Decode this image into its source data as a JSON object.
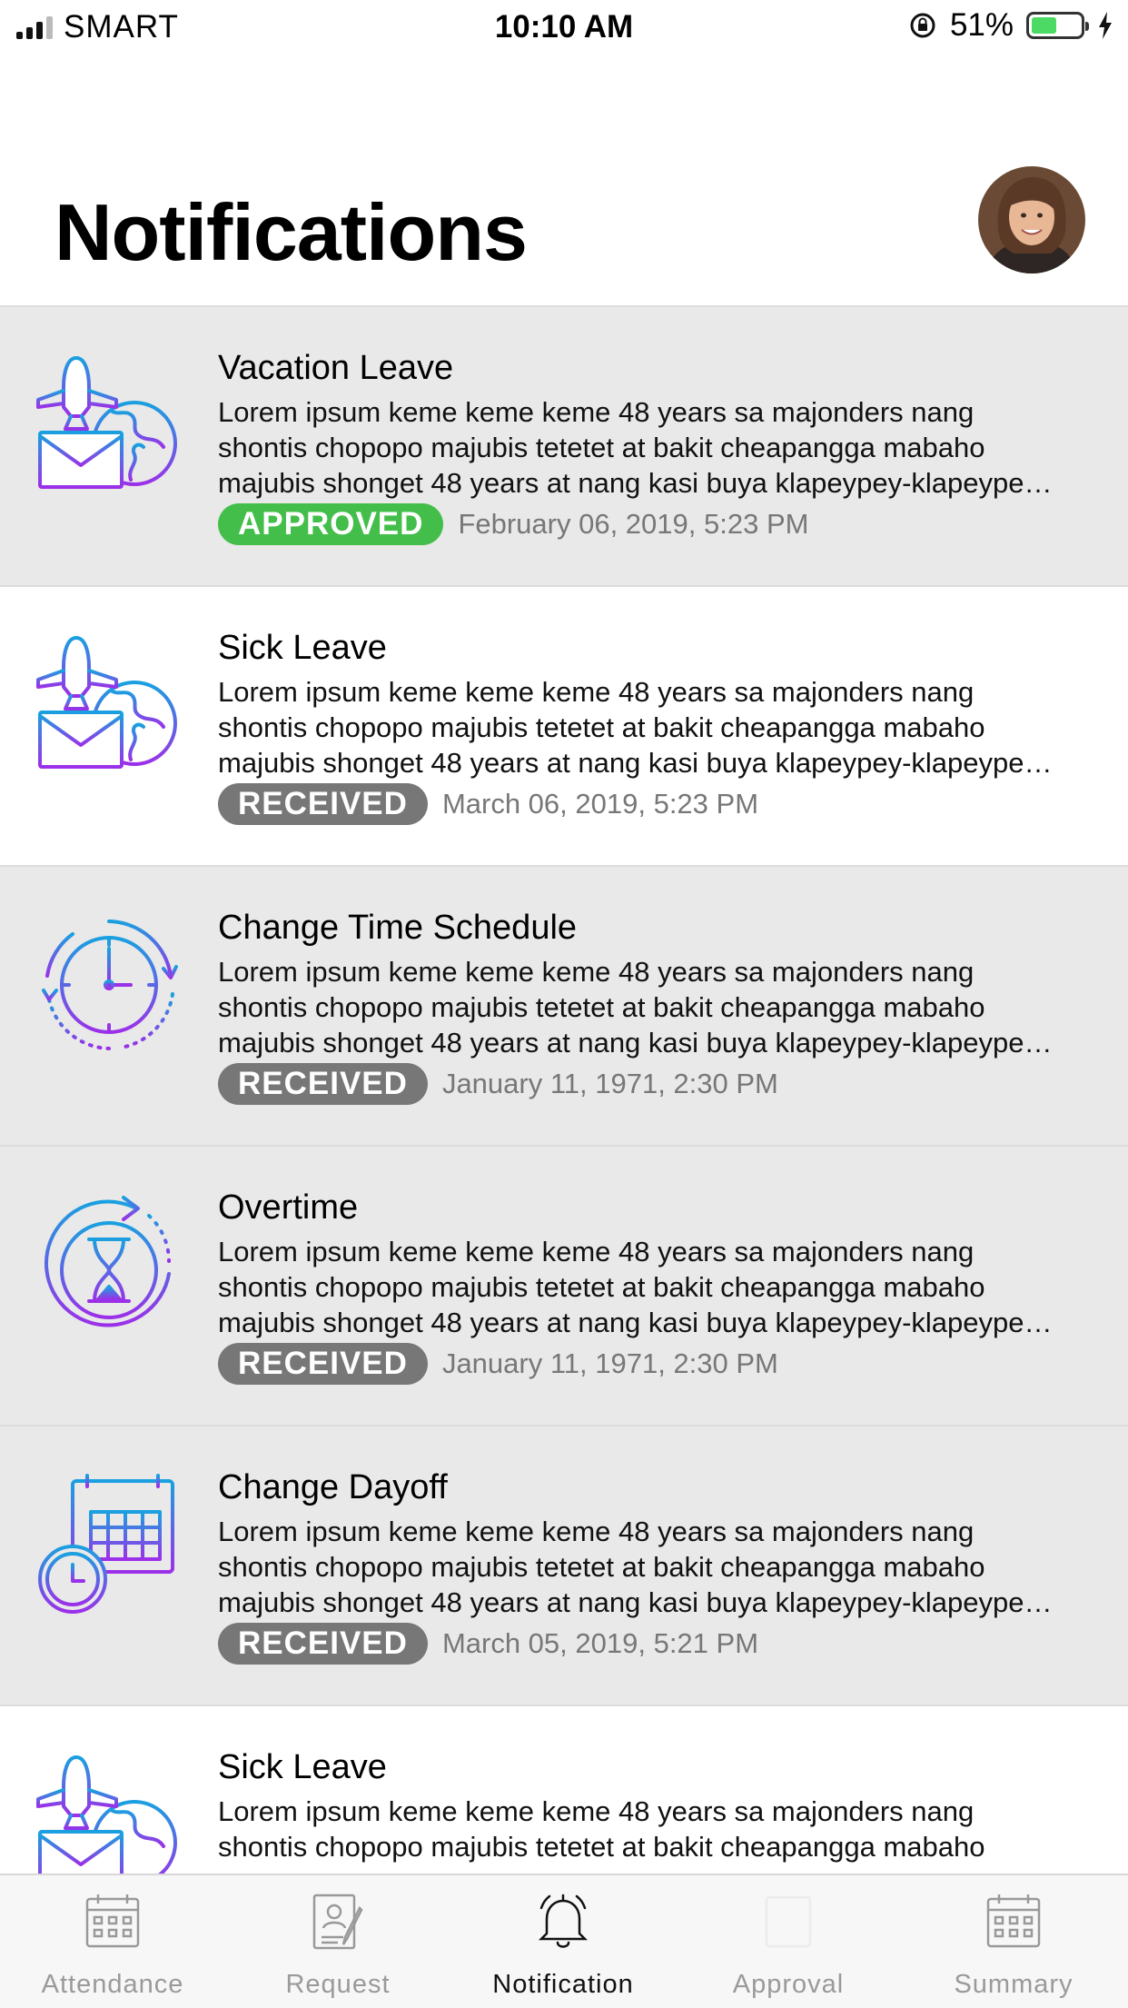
{
  "status_bar": {
    "carrier": "SMART",
    "time": "10:10 AM",
    "battery_percent": "51%",
    "battery_level": 0.51,
    "battery_color": "#4cd964"
  },
  "header": {
    "title": "Notifications"
  },
  "notifications": [
    {
      "title": "Vacation Leave",
      "icon": "plane-envelope-globe-icon",
      "body": [
        "Lorem ipsum keme keme keme 48 years sa majonders nang",
        "shontis chopopo majubis tetetet at bakit cheapangga mabaho",
        "majubis shonget 48 years at nang kasi buya klapeypey-klapeype…"
      ],
      "status": "APPROVED",
      "date": "February 06, 2019, 5:23 PM"
    },
    {
      "title": "Sick Leave",
      "icon": "plane-envelope-globe-icon",
      "body": [
        "Lorem ipsum keme keme keme 48 years sa majonders nang",
        "shontis chopopo majubis tetetet at bakit cheapangga mabaho",
        "majubis shonget 48 years at nang kasi buya klapeypey-klapeype…"
      ],
      "status": "RECEIVED",
      "date": "March 06, 2019, 5:23 PM"
    },
    {
      "title": "Change Time Schedule",
      "icon": "clock-icon",
      "body": [
        "Lorem ipsum keme keme keme 48 years sa majonders nang",
        "shontis chopopo majubis tetetet at bakit cheapangga mabaho",
        "majubis shonget 48 years at nang kasi buya klapeypey-klapeype…"
      ],
      "status": "RECEIVED",
      "date": "January 11, 1971, 2:30 PM"
    },
    {
      "title": "Overtime",
      "icon": "hourglass-icon",
      "body": [
        "Lorem ipsum keme keme keme 48 years sa majonders nang",
        "shontis chopopo majubis tetetet at bakit cheapangga mabaho",
        "majubis shonget 48 years at nang kasi buya klapeypey-klapeype…"
      ],
      "status": "RECEIVED",
      "date": "January 11, 1971, 2:30 PM"
    },
    {
      "title": "Change Dayoff",
      "icon": "calendar-clock-icon",
      "body": [
        "Lorem ipsum keme keme keme 48 years sa majonders nang",
        "shontis chopopo majubis tetetet at bakit cheapangga mabaho",
        "majubis shonget 48 years at nang kasi buya klapeypey-klapeype…"
      ],
      "status": "RECEIVED",
      "date": "March 05, 2019, 5:21 PM"
    },
    {
      "title": "Sick Leave",
      "icon": "plane-envelope-globe-icon",
      "body": [
        "Lorem ipsum keme keme keme 48 years sa majonders nang",
        "shontis chopopo majubis tetetet at bakit cheapangga mabaho"
      ]
    }
  ],
  "tab_bar": {
    "tabs": [
      {
        "label": "Attendance",
        "icon": "calendar-icon"
      },
      {
        "label": "Request",
        "icon": "document-pen-icon"
      },
      {
        "label": "Notification",
        "icon": "bell-icon"
      },
      {
        "label": "Approval",
        "icon": "approval-icon"
      },
      {
        "label": "Summary",
        "icon": "calendar-summary-icon"
      }
    ],
    "active": "Notification"
  },
  "colors": {
    "approved": "#44be4a",
    "received": "#777777",
    "icon_gradient_start": "#1aa0e0",
    "icon_gradient_end": "#9b30e8"
  }
}
